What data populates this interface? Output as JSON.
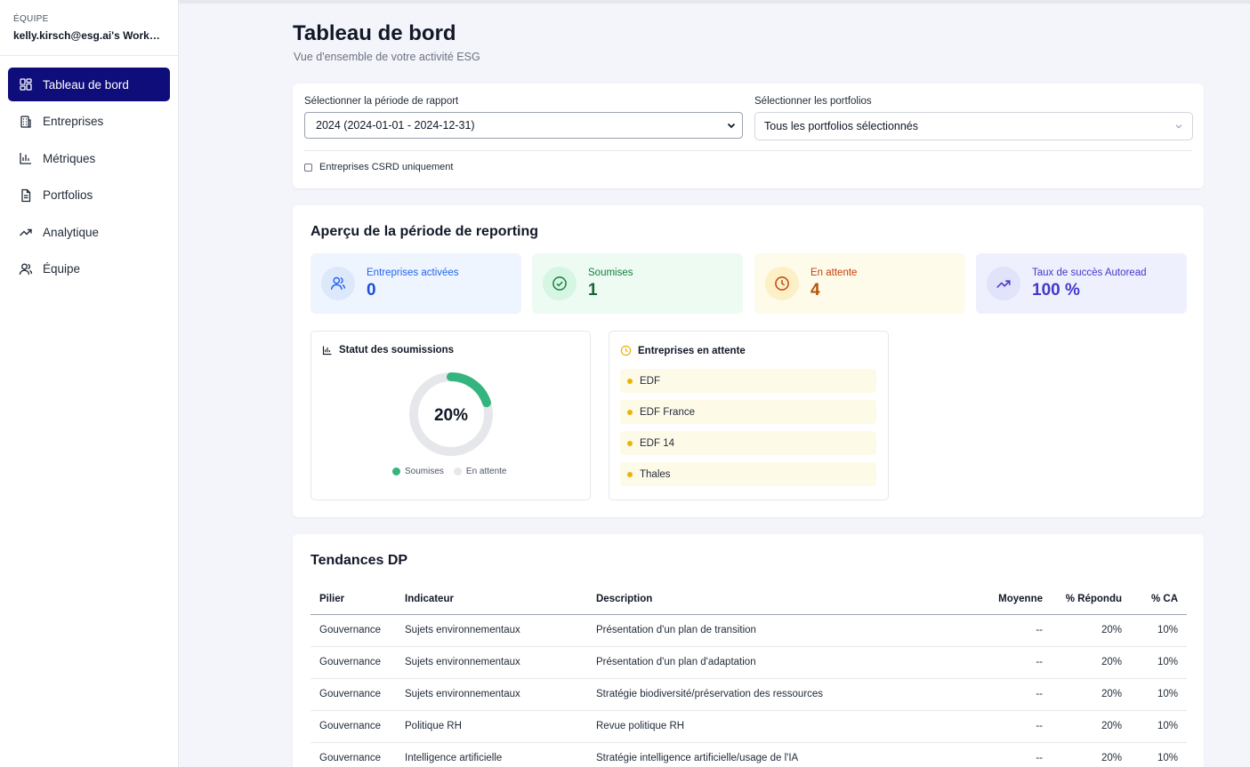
{
  "sidebar": {
    "team_label": "ÉQUIPE",
    "team_name": "kelly.kirsch@esg.ai's Workspace",
    "items": [
      {
        "label": "Tableau de bord",
        "icon": "dashboard-icon"
      },
      {
        "label": "Entreprises",
        "icon": "building-icon"
      },
      {
        "label": "Métriques",
        "icon": "bar-chart-icon"
      },
      {
        "label": "Portfolios",
        "icon": "document-icon"
      },
      {
        "label": "Analytique",
        "icon": "trending-up-icon"
      },
      {
        "label": "Équipe",
        "icon": "users-icon"
      }
    ]
  },
  "header": {
    "title": "Tableau de bord",
    "subtitle": "Vue d'ensemble de votre activité ESG"
  },
  "filters": {
    "period_label": "Sélectionner la période de rapport",
    "period_value": "2024 (2024-01-01 - 2024-12-31)",
    "portfolio_label": "Sélectionner les portfolios",
    "portfolio_value": "Tous les portfolios sélectionnés",
    "csrd_label": "Entreprises CSRD uniquement",
    "csrd_checked": false
  },
  "overview": {
    "title": "Aperçu de la période de reporting",
    "stats": [
      {
        "label": "Entreprises activées",
        "value": "0",
        "icon": "users-icon",
        "color": "#2563eb",
        "bg": "#eef5ff"
      },
      {
        "label": "Soumises",
        "value": "1",
        "icon": "check-circle-icon",
        "color": "#15803d",
        "bg": "#edfbf3"
      },
      {
        "label": "En attente",
        "value": "4",
        "icon": "clock-icon",
        "color": "#c2410c",
        "bg": "#fefbea"
      },
      {
        "label": "Taux de succès Autoread",
        "value": "100 %",
        "icon": "trending-up-icon",
        "color": "#4338ca",
        "bg": "#eef0fd"
      }
    ],
    "submissions": {
      "title": "Statut des soumissions",
      "percent": 20,
      "percent_label": "20%",
      "legend": [
        {
          "label": "Soumises",
          "color": "#34b47e"
        },
        {
          "label": "En attente",
          "color": "#e5e7eb"
        }
      ]
    },
    "pending": {
      "title": "Entreprises en attente",
      "items": [
        "EDF",
        "EDF France",
        "EDF 14",
        "Thales"
      ]
    }
  },
  "trends": {
    "title": "Tendances DP",
    "columns": [
      "Pilier",
      "Indicateur",
      "Description",
      "Moyenne",
      "% Répondu",
      "% CA"
    ],
    "rows": [
      [
        "Gouvernance",
        "Sujets environnementaux",
        "Présentation d'un plan de transition",
        "--",
        "20%",
        "10%"
      ],
      [
        "Gouvernance",
        "Sujets environnementaux",
        "Présentation d'un plan d'adaptation",
        "--",
        "20%",
        "10%"
      ],
      [
        "Gouvernance",
        "Sujets environnementaux",
        "Stratégie biodiversité/préservation des ressources",
        "--",
        "20%",
        "10%"
      ],
      [
        "Gouvernance",
        "Politique RH",
        "Revue politique RH",
        "--",
        "20%",
        "10%"
      ],
      [
        "Gouvernance",
        "Intelligence artificielle",
        "Stratégie intelligence artificielle/usage de l'IA",
        "--",
        "20%",
        "10%"
      ]
    ]
  }
}
